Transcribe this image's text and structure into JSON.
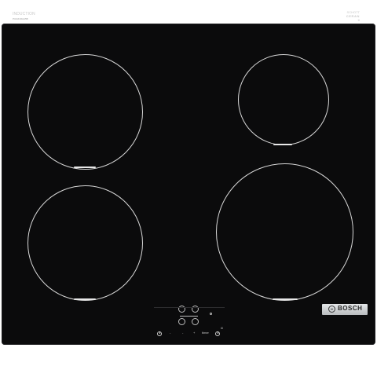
{
  "brand": {
    "line": "INDUCTION",
    "model": "PUG61RAA5B",
    "glass_top": "SCHOTT",
    "glass_name": "CERAN",
    "glass_sub": "®",
    "maker": "BOSCH"
  },
  "controls": {
    "power_label": "",
    "minus_left": "-",
    "minus_right": "-",
    "plus_label": "+",
    "slider_label": "0-9",
    "timer_label": "timer",
    "right_indicator": "◊",
    "status_label": "○",
    "heat_label": "iii"
  },
  "colors": {
    "glass": "#0b0b0c",
    "zone_outline": "#d8d8d8",
    "logo_plate": "#cfd1d3"
  }
}
